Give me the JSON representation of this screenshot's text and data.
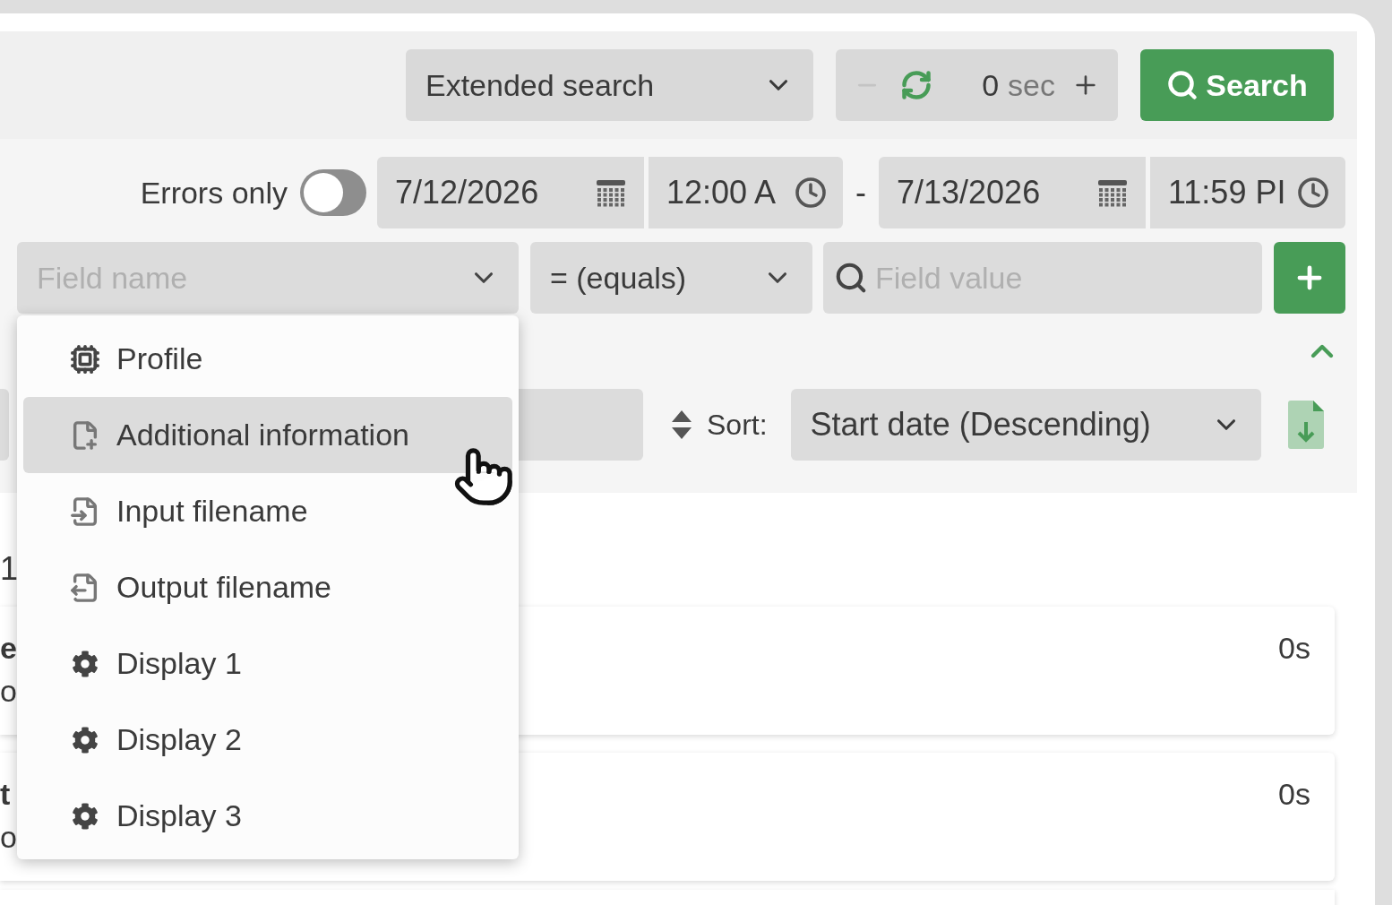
{
  "header": {
    "mode_select": "Extended search",
    "refresh": {
      "value": "0",
      "unit": "sec"
    },
    "search_button": "Search"
  },
  "filters": {
    "errors_only": {
      "label": "Errors only",
      "on": false
    },
    "from_date": "7/12/2026",
    "from_time": "12:00 A",
    "separator": "-",
    "to_date": "7/13/2026",
    "to_time": "11:59 PI",
    "field_name": {
      "placeholder": "Field name"
    },
    "operator": "= (equals)",
    "field_value": {
      "placeholder": "Field value"
    }
  },
  "sort": {
    "label": "Sort:",
    "value": "Start date (Descending)"
  },
  "results": {
    "heading": "1",
    "cards": [
      {
        "title": "e",
        "subtitle": "o",
        "duration": "0s"
      },
      {
        "title": "t",
        "subtitle": "o",
        "duration": "0s"
      }
    ]
  },
  "field_menu": [
    {
      "label": "Profile",
      "kind": "chip",
      "selected": false
    },
    {
      "label": "Additional information",
      "kind": "file-plus",
      "selected": true
    },
    {
      "label": "Input filename",
      "kind": "file-in",
      "selected": false
    },
    {
      "label": "Output filename",
      "kind": "file-out",
      "selected": false
    },
    {
      "label": "Display 1",
      "kind": "gear",
      "selected": false
    },
    {
      "label": "Display 2",
      "kind": "gear",
      "selected": false
    },
    {
      "label": "Display 3",
      "kind": "gear",
      "selected": false
    }
  ]
}
